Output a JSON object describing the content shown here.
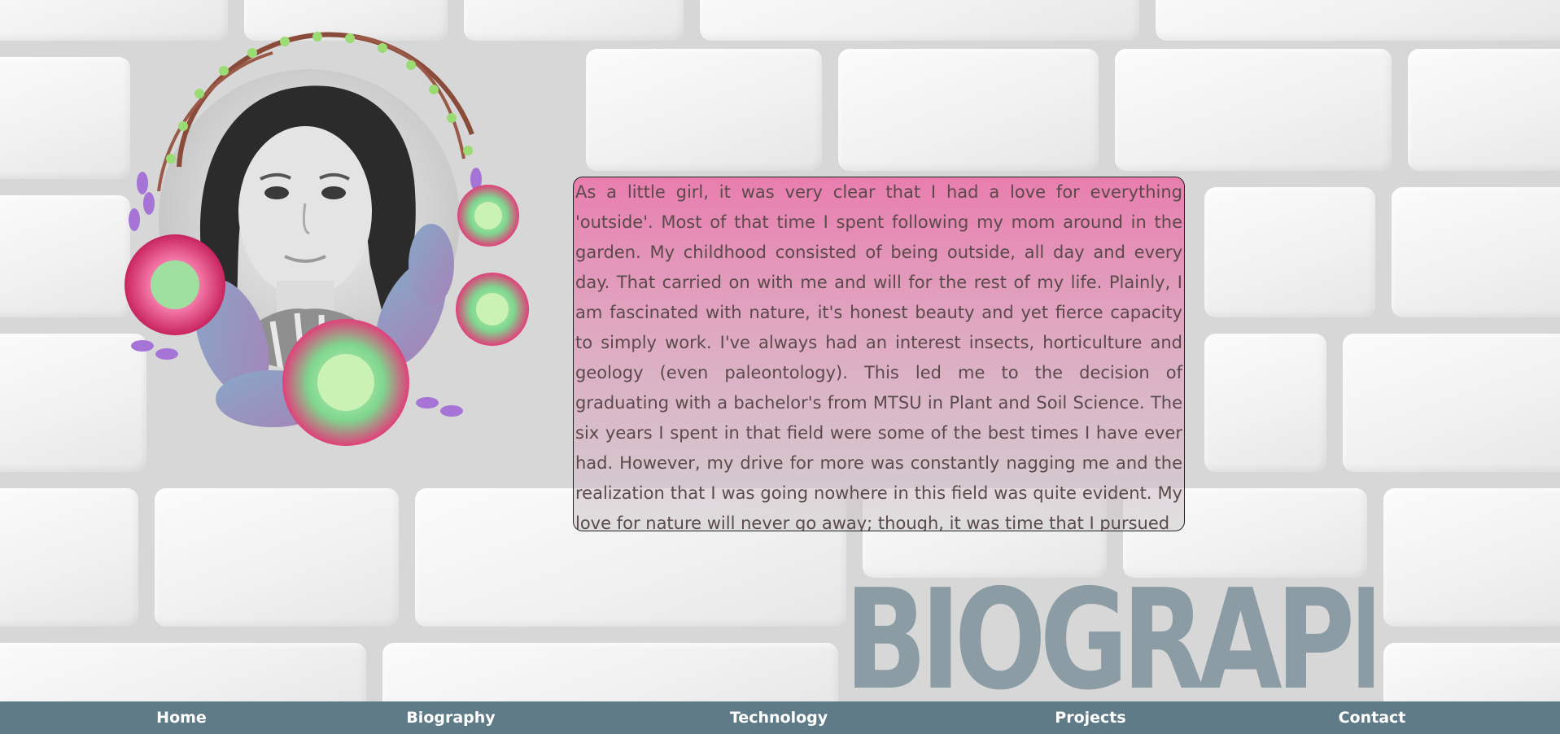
{
  "bio": {
    "text": "As a little girl, it was very clear that I had a love for everything 'outside'. Most of that time I spent following my mom around in the garden. My childhood consisted of being outside, all day and every day. That carried on with me and will for the rest of my life. Plainly, I am fascinated with nature, it's honest beauty and yet fierce capacity to simply work. I've always had an interest insects, horticulture and geology (even paleontology). This led me to the decision of graduating with a bachelor's from MTSU in Plant and Soil Science. The six years I spent in that field were some of the best times I have ever had. However, my drive for more was constantly nagging me and the realization that I was going nowhere in this field was quite evident. My love for nature will never go away; though, it was time that I pursued"
  },
  "heading": "BIOGRAPHY",
  "nav": {
    "home": "Home",
    "biography": "Biography",
    "technology": "Technology",
    "projects": "Projects",
    "contact": "Contact"
  },
  "colors": {
    "nav_bg": "#5f7b88",
    "panel_pink": "#ec6ea8",
    "heading": "#8c9ca4"
  }
}
